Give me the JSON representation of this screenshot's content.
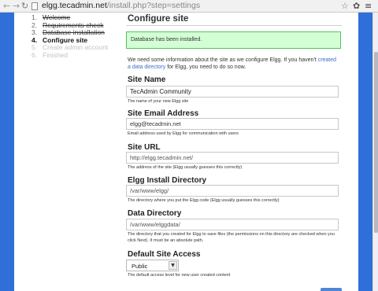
{
  "browser": {
    "url_host": "elgg.tecadmin.net",
    "url_path": "/install.php?step=settings"
  },
  "steps": [
    {
      "num": "1.",
      "label": "Welcome"
    },
    {
      "num": "2.",
      "label": "Requirements check"
    },
    {
      "num": "3.",
      "label": "Database installation"
    },
    {
      "num": "4.",
      "label": "Configure site"
    },
    {
      "num": "5.",
      "label": "Create admin account"
    },
    {
      "num": "6.",
      "label": "Finished"
    }
  ],
  "main": {
    "title": "Configure site",
    "alert": "Database has been installed.",
    "intro_before": "We need some information about the site as we configure Elgg. If you haven't ",
    "intro_link": "created a data directory",
    "intro_after": " for Elgg, you need to do so now."
  },
  "form": {
    "site_name": {
      "label": "Site Name",
      "value": "TecAdmin Community",
      "help": "The name of your new Elgg site"
    },
    "site_email": {
      "label": "Site Email Address",
      "value": "elgg@tecadmin.net",
      "help": "Email address used by Elgg for communication with users"
    },
    "site_url": {
      "label": "Site URL",
      "value": "http://elgg.tecadmin.net/",
      "help": "The address of the site (Elgg usually guesses this correctly)"
    },
    "install_dir": {
      "label": "Elgg Install Directory",
      "value": "/var/www/elgg/",
      "help": "The directory where you put the Elgg code (Elgg usually guesses this correctly)"
    },
    "data_dir": {
      "label": "Data Directory",
      "value": "/var/www/elggdata/",
      "help": "The directory that you created for Elgg to save files (the permissions on this directory are checked when you click Next). It must be an absolute path."
    },
    "access": {
      "label": "Default Site Access",
      "value": "Public",
      "help": "The default access level for new user created content"
    }
  }
}
